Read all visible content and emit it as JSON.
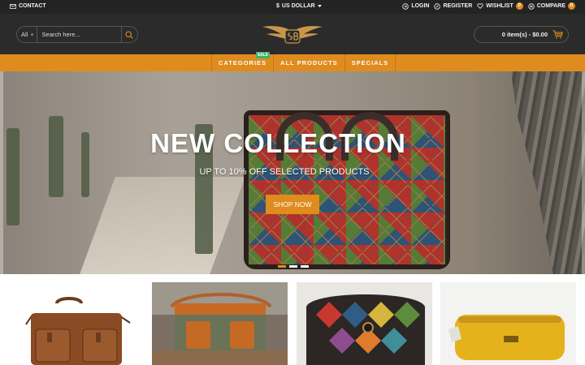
{
  "topbar": {
    "contact_label": "CONTACT",
    "currency_symbol": "$",
    "currency_label": "US DOLLAR",
    "login_label": "LOGIN",
    "register_label": "REGISTER",
    "wishlist_label": "WISHLIST",
    "wishlist_count": "0",
    "compare_label": "COMPARE",
    "compare_count": "0"
  },
  "header": {
    "search_category": "All",
    "search_placeholder": "Search here...",
    "cart_summary": "0 item(s) - $0.00"
  },
  "nav": {
    "items": [
      {
        "label": "CATEGORIES",
        "badge": "SALE"
      },
      {
        "label": "ALL PRODUCTS"
      },
      {
        "label": "SPECIALS"
      }
    ]
  },
  "hero": {
    "title": "NEW COLLECTION",
    "subtitle": "UP TO 10% OFF SELECTED PRODUCTS",
    "cta_label": "SHOP NOW",
    "slides": 3,
    "active_slide": 1
  },
  "products": [
    {
      "name": "brown leather messenger bag"
    },
    {
      "name": "canvas and leather camera bag"
    },
    {
      "name": "patchwork diamond crossbody bag"
    },
    {
      "name": "yellow leather toiletry pouch"
    }
  ],
  "colors": {
    "accent": "#e08b1e",
    "topbar_bg": "#232323",
    "header_bg": "#2b2b2b",
    "sale_badge": "#3db36b"
  },
  "icons": {
    "contact": "envelope-icon",
    "currency_caret": "caret-down-icon",
    "login": "login-icon",
    "register": "edit-icon",
    "wishlist": "heart-icon",
    "compare": "compare-icon",
    "search": "search-icon",
    "cart": "cart-icon"
  }
}
